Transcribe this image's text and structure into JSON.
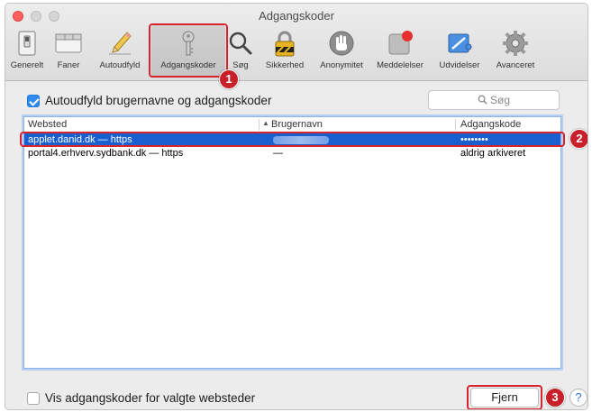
{
  "window": {
    "title": "Adgangskoder"
  },
  "toolbar": {
    "items": [
      {
        "label": "Generelt",
        "icon": "general-switch-icon"
      },
      {
        "label": "Faner",
        "icon": "tabs-window-icon"
      },
      {
        "label": "Autoudfyld",
        "icon": "pencil-autofill-icon"
      },
      {
        "label": "Adgangskoder",
        "icon": "key-icon",
        "active": true
      },
      {
        "label": "Søg",
        "icon": "magnifier-icon"
      },
      {
        "label": "Sikkerhed",
        "icon": "padlock-icon"
      },
      {
        "label": "Anonymitet",
        "icon": "hand-icon"
      },
      {
        "label": "Meddelelser",
        "icon": "notification-badge-icon"
      },
      {
        "label": "Udvidelser",
        "icon": "puzzle-extensions-icon"
      },
      {
        "label": "Avanceret",
        "icon": "gear-icon"
      }
    ]
  },
  "autofill": {
    "label": "Autoudfyld brugernavne og adgangskoder",
    "checked": true
  },
  "search": {
    "placeholder": "Søg"
  },
  "table": {
    "columns": [
      "Websted",
      "Brugernavn",
      "Adgangskode"
    ],
    "rows": [
      {
        "site": "applet.danid.dk — https",
        "user": "",
        "password": "••••••••",
        "selected": true
      },
      {
        "site": "portal4.erhverv.sydbank.dk — https",
        "user": "—",
        "password": "aldrig arkiveret",
        "selected": false
      }
    ]
  },
  "show_passwords": {
    "label": "Vis adgangskoder for valgte websteder",
    "checked": false
  },
  "buttons": {
    "remove": "Fjern",
    "help": "?"
  },
  "callouts": [
    "1",
    "2",
    "3"
  ],
  "colors": {
    "accent": "#2f8bef",
    "selection": "#1a5fd0",
    "callout": "#d9232d"
  }
}
